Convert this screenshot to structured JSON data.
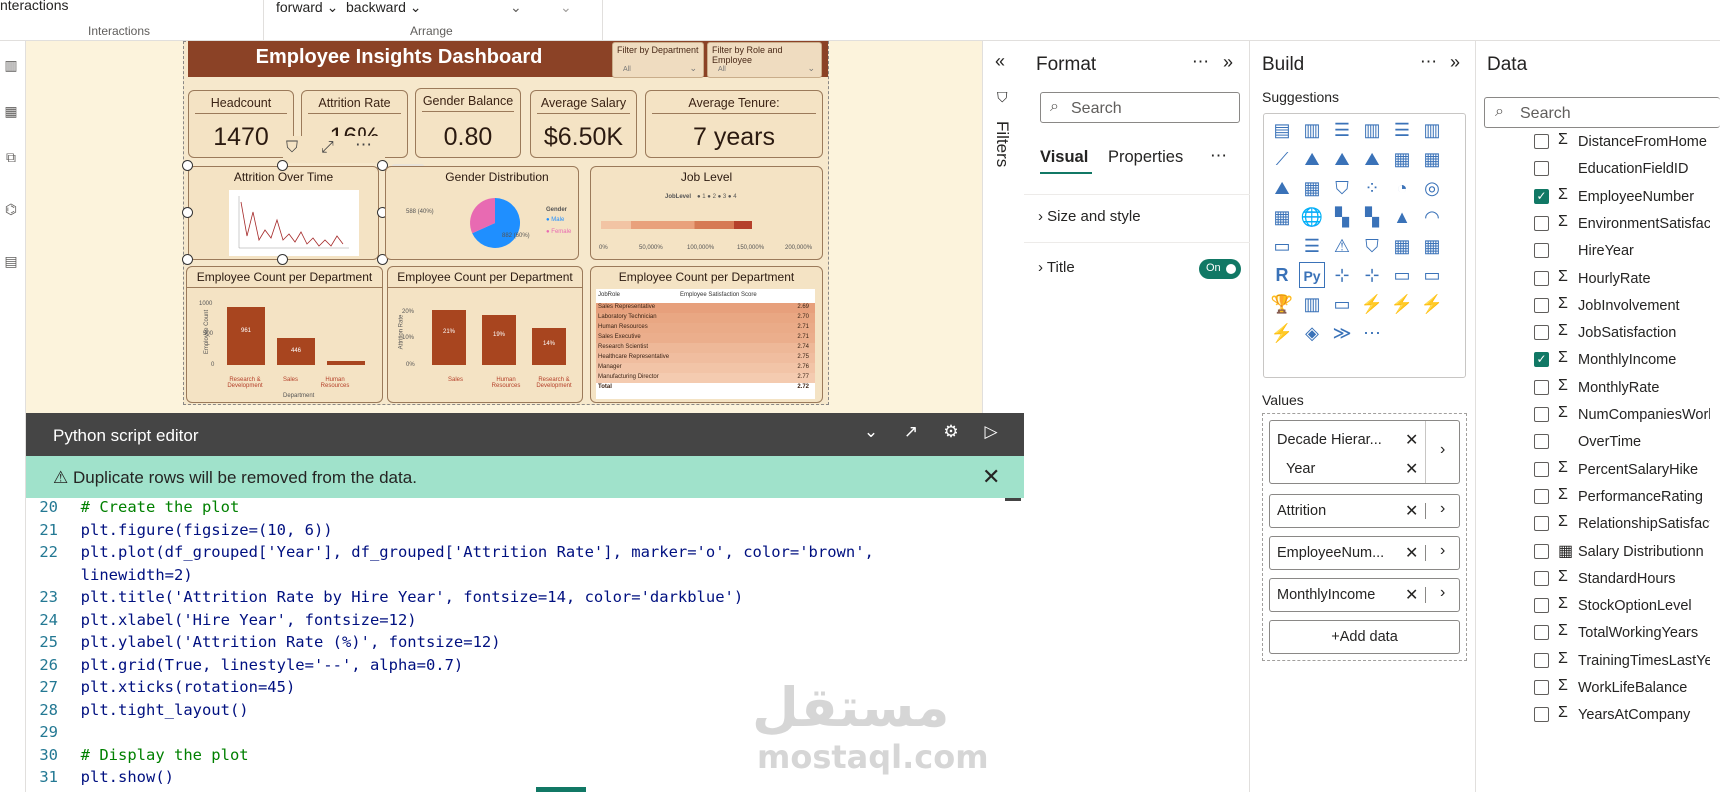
{
  "ribbon": {
    "interactions_btn": "nteractions",
    "interactions_group": "Interactions",
    "forward": "forward",
    "backward": "backward",
    "arrange_group": "Arrange"
  },
  "dashboard": {
    "title": "Employee Insights Dashboard",
    "filter_department": {
      "label": "Filter by Department",
      "value": "All"
    },
    "filter_role": {
      "label": "Filter by Role and Employee",
      "value": "All"
    },
    "kpis": [
      {
        "label": "Headcount",
        "value": "1470"
      },
      {
        "label": "Attrition Rate",
        "value": "16%"
      },
      {
        "label": "Gender Balance",
        "value": "0.80"
      },
      {
        "label": "Average Salary",
        "value": "$6.50K"
      },
      {
        "label": "Average Tenure:",
        "value": "7 years"
      }
    ],
    "attrition_over_time": {
      "title": "Attrition Over Time"
    },
    "gender": {
      "title": "Gender Distribution",
      "legend_title": "Gender",
      "legend": [
        "Male",
        "Female"
      ],
      "slice_labels": [
        "588 (40%)",
        "882 (60%)"
      ],
      "colors": [
        "#1f8fff",
        "#e86ab2"
      ]
    },
    "job_level": {
      "title": "Job Level",
      "legend_title": "JobLevel",
      "legend": [
        "1",
        "2",
        "3",
        "4"
      ],
      "ticks": [
        "0%",
        "50,000%",
        "100,000%",
        "150,000%",
        "200,000%"
      ]
    },
    "dept_count": {
      "title": "Employee Count per Department",
      "ylabel": "Employee Count",
      "xlabel": "Department",
      "yticks": [
        "1000",
        "500",
        "0"
      ],
      "categories": [
        "Research & Development",
        "Sales",
        "Human Resources"
      ],
      "values": [
        961,
        446,
        63
      ],
      "labels": [
        "961",
        "446",
        ""
      ],
      "ymax": 1000
    },
    "dept_attrition": {
      "title": "Employee Count per Department",
      "ylabel": "Attrition Rate",
      "yticks": [
        "20%",
        "10%",
        "0%"
      ],
      "categories": [
        "Sales",
        "Human Resources",
        "Research & Development"
      ],
      "values": [
        21,
        19,
        14
      ],
      "labels": [
        "21%",
        "19%",
        "14%"
      ],
      "ymax": 25
    },
    "satisfaction_table": {
      "title": "Employee Count per Department",
      "headers": [
        "JobRole",
        "Employee Satisfaction Score"
      ],
      "rows": [
        [
          "Sales Representative",
          "2.69"
        ],
        [
          "Laboratory Technician",
          "2.70"
        ],
        [
          "Human Resources",
          "2.71"
        ],
        [
          "Sales Executive",
          "2.71"
        ],
        [
          "Research Scientist",
          "2.74"
        ],
        [
          "Healthcare Representative",
          "2.75"
        ],
        [
          "Manager",
          "2.76"
        ],
        [
          "Manufacturing Director",
          "2.77"
        ]
      ],
      "total": [
        "Total",
        "2.72"
      ]
    }
  },
  "python_editor": {
    "title": "Python script editor",
    "warning": "Duplicate rows will be removed from the data.",
    "lines": [
      {
        "n": "20",
        "t": "# Create the plot"
      },
      {
        "n": "21",
        "t": "plt.figure(figsize=(10, 6))"
      },
      {
        "n": "22",
        "t": "plt.plot(df_grouped['Year'], df_grouped['Attrition Rate'], marker='o', color='brown',"
      },
      {
        "n": "",
        "t": "linewidth=2)"
      },
      {
        "n": "23",
        "t": "plt.title('Attrition Rate by Hire Year', fontsize=14, color='darkblue')"
      },
      {
        "n": "24",
        "t": "plt.xlabel('Hire Year', fontsize=12)"
      },
      {
        "n": "25",
        "t": "plt.ylabel('Attrition Rate (%)', fontsize=12)"
      },
      {
        "n": "26",
        "t": "plt.grid(True, linestyle='--', alpha=0.7)"
      },
      {
        "n": "27",
        "t": "plt.xticks(rotation=45)"
      },
      {
        "n": "28",
        "t": "plt.tight_layout()"
      },
      {
        "n": "29",
        "t": ""
      },
      {
        "n": "30",
        "t": "# Display the plot"
      },
      {
        "n": "31",
        "t": "plt.show()"
      }
    ],
    "watermark_ar": "مستقل",
    "watermark_en": "mostaql.com"
  },
  "filters": {
    "label": "Filters"
  },
  "format": {
    "title": "Format",
    "search_placeholder": "Search",
    "tab_visual": "Visual",
    "tab_properties": "Properties",
    "size_style": "Size and style",
    "title_section": "Title",
    "toggle": "On"
  },
  "build": {
    "title": "Build",
    "suggestions": "Suggestions",
    "values_label": "Values",
    "wells": [
      "Decade Hierar...",
      "Year",
      "Attrition",
      "EmployeeNum...",
      "MonthlyIncome"
    ],
    "add_data": "+Add data"
  },
  "data": {
    "title": "Data",
    "search_placeholder": "Search",
    "fields": [
      {
        "name": "DistanceFromHome",
        "sigma": true,
        "checked": false
      },
      {
        "name": "EducationFieldID",
        "sigma": false,
        "checked": false
      },
      {
        "name": "EmployeeNumber",
        "sigma": true,
        "checked": true
      },
      {
        "name": "EnvironmentSatisfaction",
        "sigma": true,
        "checked": false
      },
      {
        "name": "HireYear",
        "sigma": false,
        "checked": false
      },
      {
        "name": "HourlyRate",
        "sigma": true,
        "checked": false
      },
      {
        "name": "JobInvolvement",
        "sigma": true,
        "checked": false
      },
      {
        "name": "JobSatisfaction",
        "sigma": true,
        "checked": false
      },
      {
        "name": "MonthlyIncome",
        "sigma": true,
        "checked": true
      },
      {
        "name": "MonthlyRate",
        "sigma": true,
        "checked": false
      },
      {
        "name": "NumCompaniesWorked",
        "sigma": true,
        "checked": false
      },
      {
        "name": "OverTime",
        "sigma": false,
        "checked": false
      },
      {
        "name": "PercentSalaryHike",
        "sigma": true,
        "checked": false
      },
      {
        "name": "PerformanceRating",
        "sigma": true,
        "checked": false
      },
      {
        "name": "RelationshipSatisfaction",
        "sigma": true,
        "checked": false
      },
      {
        "name": "Salary Distributionn",
        "sigma": false,
        "checked": false,
        "calc": true
      },
      {
        "name": "StandardHours",
        "sigma": true,
        "checked": false
      },
      {
        "name": "StockOptionLevel",
        "sigma": true,
        "checked": false
      },
      {
        "name": "TotalWorkingYears",
        "sigma": true,
        "checked": false
      },
      {
        "name": "TrainingTimesLastYear",
        "sigma": true,
        "checked": false
      },
      {
        "name": "WorkLifeBalance",
        "sigma": true,
        "checked": false
      },
      {
        "name": "YearsAtCompany",
        "sigma": true,
        "checked": false
      }
    ]
  }
}
